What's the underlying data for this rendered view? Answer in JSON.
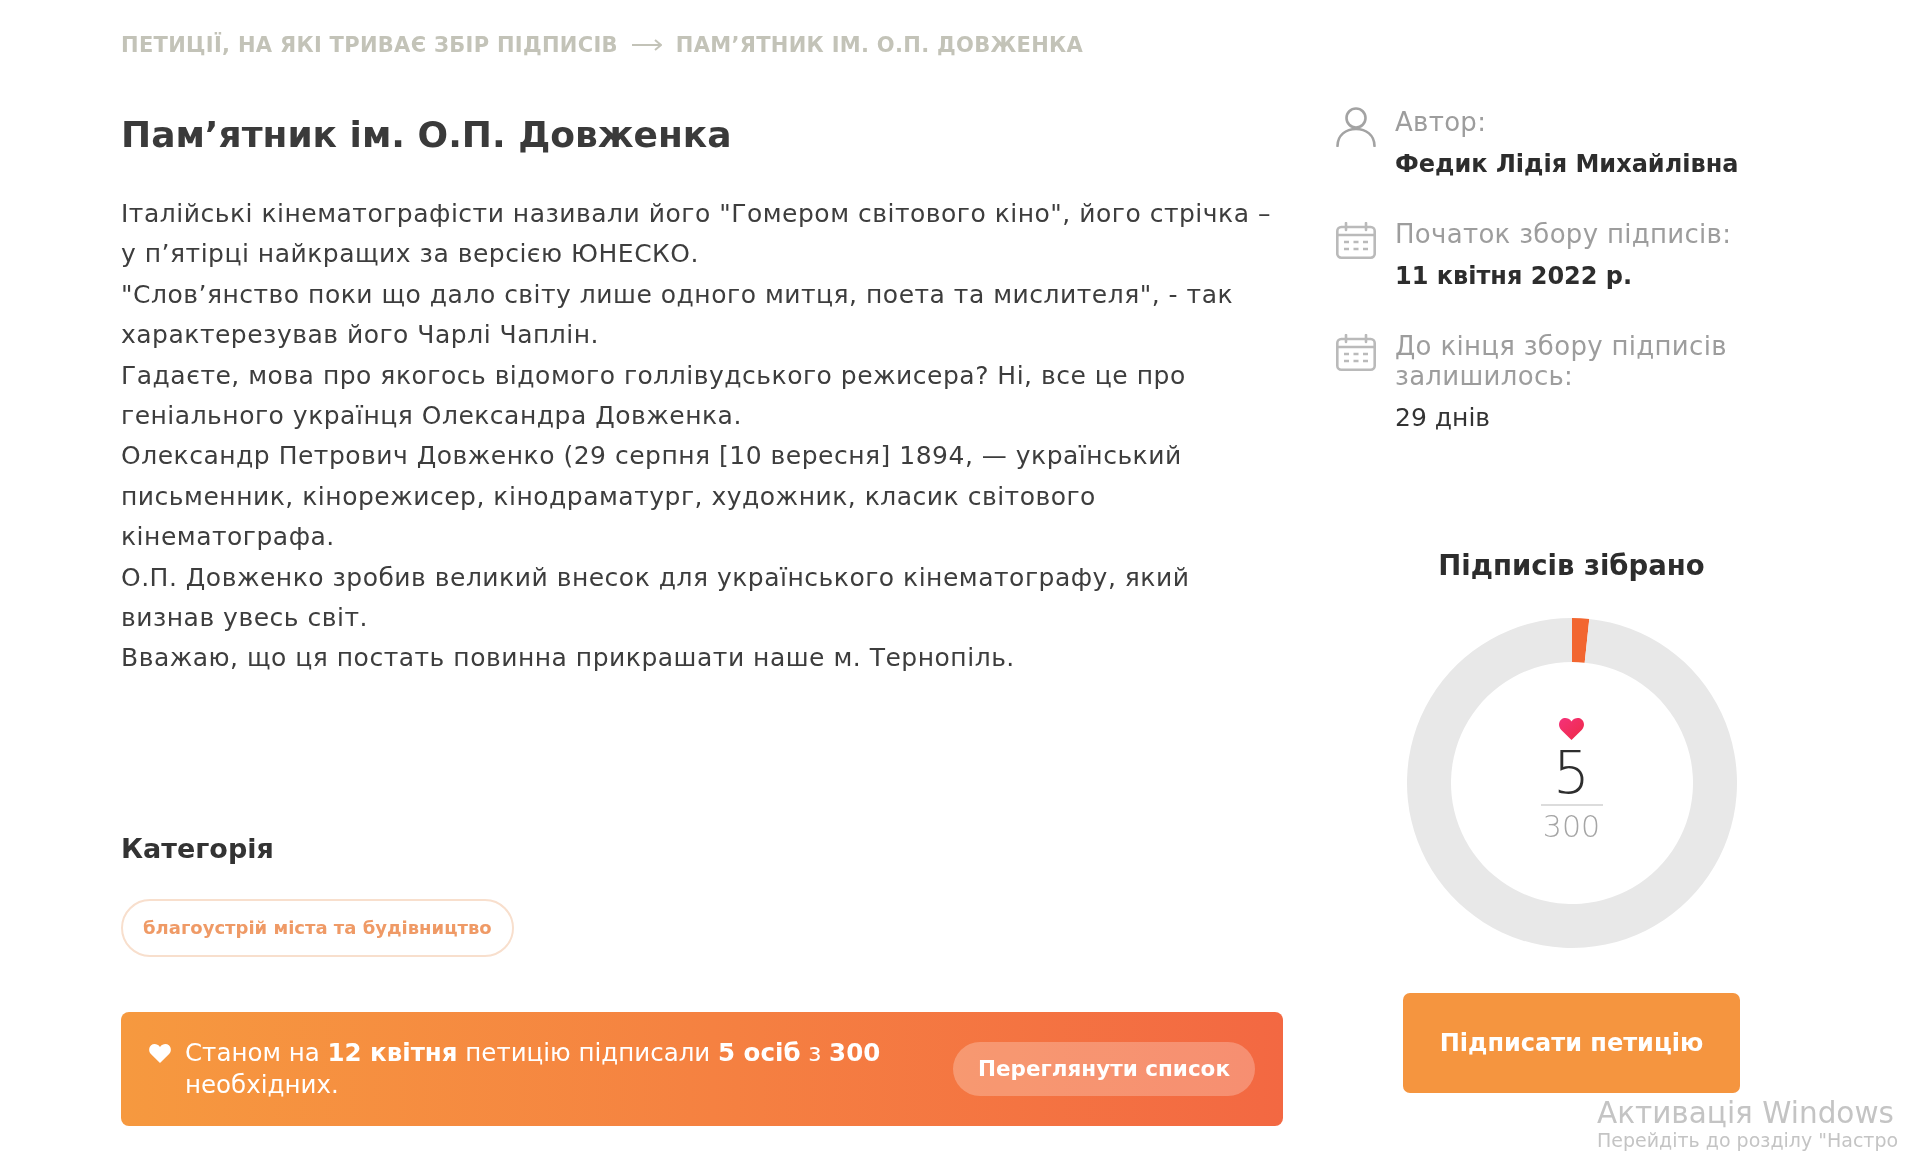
{
  "breadcrumb": [
    {
      "label": "ПЕТИЦІЇ, НА ЯКІ ТРИВАЄ ЗБІР ПІДПИСІВ"
    },
    {
      "label": "ПАМ’ЯТНИК ІМ. О.П. ДОВЖЕНКА"
    }
  ],
  "title": "Пам’ятник ім. О.П. Довженка",
  "description": [
    "Італійські кінематографісти називали його \"Гомером світового кіно\", його стрічка – у п’ятірці найкращих за версією ЮНЕСКО.",
    "\"Слов’янство поки що дало світу лише одного митця, поета та мислителя\", - так характерезував його Чарлі Чаплін.",
    "Гадаєте, мова про якогось відомого голлівудського режисера? Ні, все це про геніального українця Олександра Довженка.",
    "Олександр Петрович Довженко (29 серпня [10 вересня] 1894, — український письменник, кінорежисер, кінодраматург, художник, класик світового кінематографа.",
    "О.П. Довженко зробив великий внесок для українського кінематографу, який визнав увесь світ.",
    "Вважаю, що ця постать повинна прикрашати наше м. Тернопіль."
  ],
  "category": {
    "heading": "Категорія",
    "tags": [
      "благоустрій міста та будівництво"
    ]
  },
  "status_banner": {
    "text": "Станом на **12 квітня** петицію підписали **5 осіб** з **300** необхідних.",
    "button": "Переглянути список"
  },
  "details": [
    {
      "kind": "author",
      "label": "Автор:",
      "value": "Федик Лідія Михайлівна",
      "value_bold": true
    },
    {
      "kind": "date",
      "label": "Початок збору підписів:",
      "value": "11 квітня 2022 р.",
      "value_bold": true
    },
    {
      "kind": "date",
      "label": "До кінця збору підписів залишилось:",
      "value": "29 днів",
      "value_bold": false
    }
  ],
  "signatures": {
    "chart_data": {
      "type": "donut",
      "title": "Підписів зібрано",
      "values": [
        1.67,
        98.33
      ]
    },
    "count": "5",
    "goal": "300"
  },
  "sign_button": "Підписати петицію",
  "system_overlay": {
    "title": "Активація Windows",
    "subtitle": "Перейдіть до розділу \"Настро"
  }
}
